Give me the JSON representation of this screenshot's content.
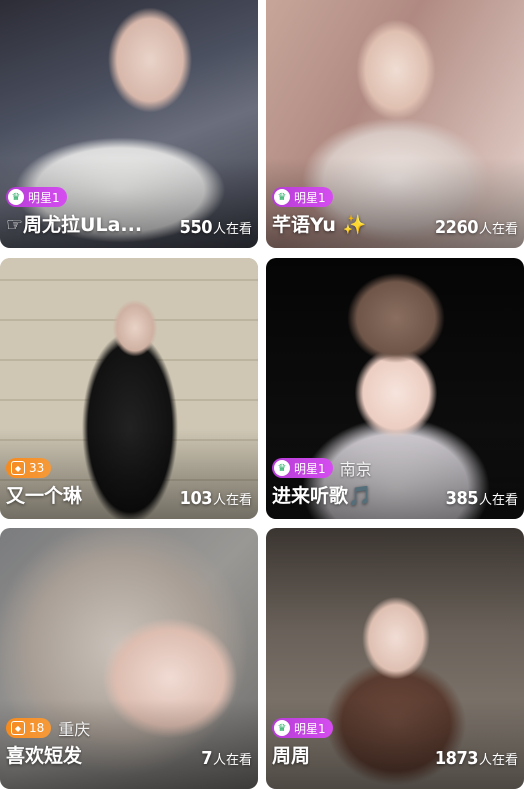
{
  "feed": {
    "cards": [
      {
        "badge_type": "star",
        "badge_icon": "shield-icon",
        "badge_label": "明星1",
        "city": "",
        "name": "☞周尤拉ULa...",
        "viewers": "550",
        "viewers_suffix": "人在看"
      },
      {
        "badge_type": "star",
        "badge_icon": "shield-icon",
        "badge_label": "明星1",
        "city": "",
        "name": "芊语Yu ✨",
        "viewers": "2260",
        "viewers_suffix": "人在看"
      },
      {
        "badge_type": "level",
        "badge_icon": "hexagon-icon",
        "badge_label": "33",
        "city": "",
        "name": "又一个琳",
        "viewers": "103",
        "viewers_suffix": "人在看"
      },
      {
        "badge_type": "star",
        "badge_icon": "shield-icon",
        "badge_label": "明星1",
        "city": "南京",
        "name": "进来听歌🎵",
        "viewers": "385",
        "viewers_suffix": "人在看"
      },
      {
        "badge_type": "level",
        "badge_icon": "hexagon-icon",
        "badge_label": "18",
        "city": "重庆",
        "name": "喜欢短发",
        "viewers": "7",
        "viewers_suffix": "人在看"
      },
      {
        "badge_type": "star",
        "badge_icon": "shield-icon",
        "badge_label": "明星1",
        "city": "",
        "name": "周周",
        "viewers": "1873",
        "viewers_suffix": "人在看"
      }
    ]
  }
}
